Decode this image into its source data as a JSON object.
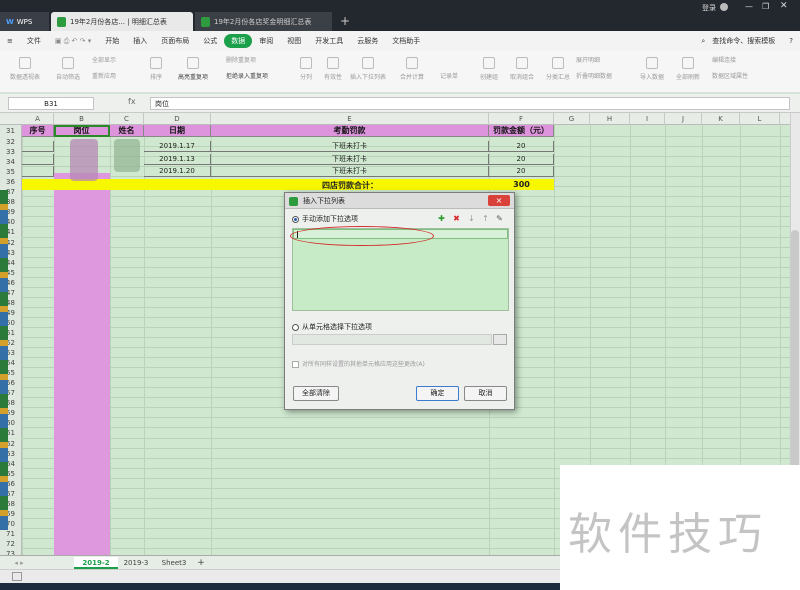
{
  "titlebar": {
    "wps": "WPS",
    "tab1": "19年2月份各店... | 明细汇总表",
    "tab2": "19年2月份各店奖金明细汇总表",
    "new_tab": "+",
    "login": "登录"
  },
  "menu": {
    "file": "文件",
    "items": [
      "开始",
      "插入",
      "页面布局",
      "公式",
      "数据",
      "审阅",
      "视图",
      "开发工具",
      "云服务",
      "文档助手"
    ],
    "active_index": 4,
    "search": "查找命令、搜索模板"
  },
  "ribbon": {
    "items": [
      "数据透视表",
      "自动筛选",
      "全部显示",
      "重新应用",
      "排序",
      "高亮重复项",
      "删除重复项",
      "拒绝录入重复项",
      "分列",
      "有效性",
      "插入下拉列表",
      "合并计算",
      "记录单",
      "创建组",
      "取消组合",
      "分类汇总",
      "展开明细",
      "折叠明细数据",
      "导入数据",
      "全部刷新",
      "编辑连接",
      "数据区域属性"
    ]
  },
  "formula_bar": {
    "cell_ref": "B31",
    "fx": "fx",
    "value": "岗位"
  },
  "columns": [
    "A",
    "B",
    "C",
    "D",
    "E",
    "F",
    "G",
    "H",
    "I",
    "J",
    "K",
    "L"
  ],
  "table": {
    "headers": [
      "序号",
      "岗位",
      "姓名",
      "日期",
      "考勤罚款",
      "罚款金额（元）"
    ],
    "rows": [
      {
        "row": "32",
        "date": "2019.1.17",
        "reason": "下班未打卡",
        "amount": "20"
      },
      {
        "row": "33",
        "date": "2019.1.13",
        "reason": "下班未打卡",
        "amount": "20"
      },
      {
        "row": "34",
        "date": "2019.1.20",
        "reason": "下班未打卡",
        "amount": "20"
      }
    ],
    "total_label": "四店罚款合计：",
    "total_value": "300"
  },
  "row_numbers": [
    "31",
    "32",
    "33",
    "34",
    "35",
    "36",
    "37",
    "38",
    "39",
    "40",
    "41",
    "42",
    "43",
    "44",
    "45",
    "46",
    "47",
    "48",
    "49",
    "50",
    "51",
    "52",
    "53",
    "54",
    "55",
    "56",
    "57",
    "58",
    "59",
    "60",
    "61",
    "62",
    "63",
    "64",
    "65",
    "66",
    "67",
    "68",
    "69",
    "70",
    "71",
    "72",
    "73"
  ],
  "dialog": {
    "title": "插入下拉列表",
    "manual_option": "手动添加下拉选项",
    "cell_option": "从单元格选择下拉选项",
    "apply_all": "对所有同样设置的其他单元格应用这些更改(A)",
    "clear_all": "全部清除",
    "ok": "确定",
    "cancel": "取消",
    "close": "×"
  },
  "sheets": {
    "tabs": [
      "2019-2",
      "2019-3",
      "Sheet3"
    ],
    "active": "2019-2",
    "add": "+"
  },
  "watermark": "软件技巧",
  "colors": {
    "header_pink": "#dd94dd",
    "total_yellow": "#f7f700",
    "grid_green": "#cfe8cf",
    "accent_green": "#1a9f4a",
    "annotation_red": "#d42b2b"
  }
}
